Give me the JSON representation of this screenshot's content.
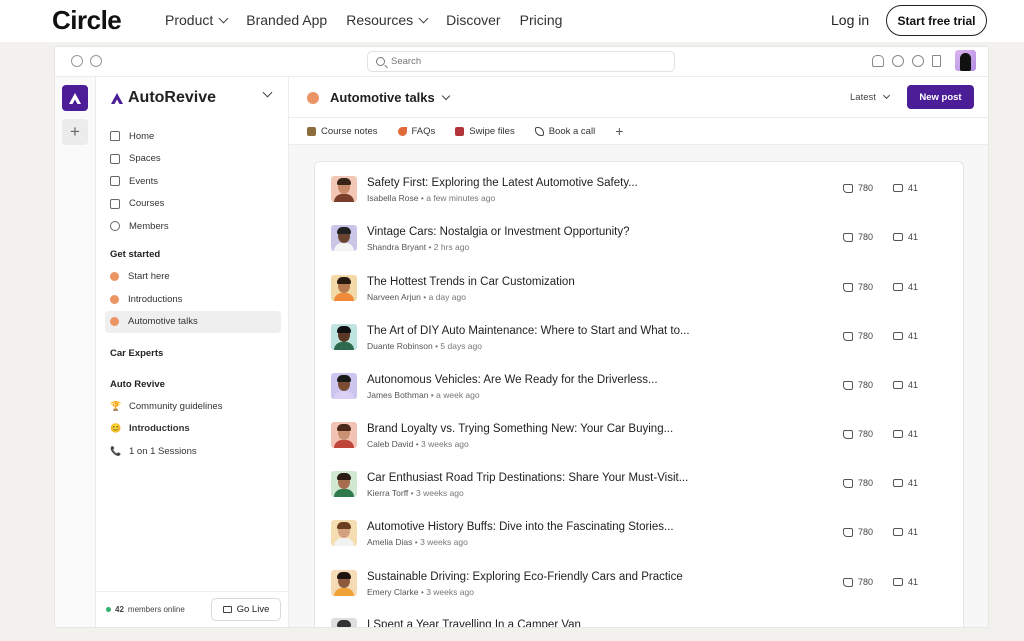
{
  "site_nav": {
    "brand": "Circle",
    "links": [
      {
        "label": "Product",
        "dropdown": true
      },
      {
        "label": "Branded App",
        "dropdown": false
      },
      {
        "label": "Resources",
        "dropdown": true
      },
      {
        "label": "Discover",
        "dropdown": false
      },
      {
        "label": "Pricing",
        "dropdown": false
      }
    ],
    "login": "Log in",
    "cta": "Start free trial"
  },
  "app": {
    "search_placeholder": "Search",
    "community_name": "AutoRevive",
    "accent": "#4b1d96",
    "space_dot_color": "#eb9464"
  },
  "sidebar": {
    "nav": [
      "Home",
      "Spaces",
      "Events",
      "Courses",
      "Members"
    ],
    "get_started": {
      "heading": "Get started",
      "items": [
        "Start here",
        "Introductions",
        "Automotive talks"
      ]
    },
    "car_experts_heading": "Car Experts",
    "auto_revive": {
      "heading": "Auto Revive",
      "items": [
        {
          "icon": "🏆",
          "label": "Community guidelines"
        },
        {
          "icon": "😊",
          "label": "Introductions"
        },
        {
          "icon": "📞",
          "label": "1 on 1 Sessions"
        }
      ]
    },
    "members_online_count": "42",
    "members_online_text": "members online",
    "go_live": "Go Live"
  },
  "main": {
    "space_title": "Automotive talks",
    "sort": "Latest",
    "new_post": "New post",
    "tabs": [
      {
        "label": "Course notes",
        "icon": "notebook-icon",
        "color": "#8a6d3b"
      },
      {
        "label": "FAQs",
        "icon": "rocket-icon",
        "color": "#e06a3a"
      },
      {
        "label": "Swipe files",
        "icon": "book-icon",
        "color": "#b0343a"
      },
      {
        "label": "Book a call",
        "icon": "phone-icon",
        "color": "#444444"
      }
    ]
  },
  "posts": [
    {
      "title": "Safety First: Exploring the Latest Automotive Safety...",
      "author": "Isabella Rose",
      "time": "a few minutes ago",
      "likes": "780",
      "comments": "41"
    },
    {
      "title": "Vintage Cars: Nostalgia or Investment Opportunity?",
      "author": "Shandra Bryant",
      "time": "2 hrs ago",
      "likes": "780",
      "comments": "41"
    },
    {
      "title": "The Hottest Trends in Car Customization",
      "author": "Narveen Arjun",
      "time": "a day ago",
      "likes": "780",
      "comments": "41"
    },
    {
      "title": "The Art of DIY Auto Maintenance: Where to Start and What to...",
      "author": "Duante Robinson",
      "time": "5 days ago",
      "likes": "780",
      "comments": "41"
    },
    {
      "title": "Autonomous Vehicles: Are We Ready for the Driverless...",
      "author": "James Bothman",
      "time": "a week ago",
      "likes": "780",
      "comments": "41"
    },
    {
      "title": "Brand Loyalty vs. Trying Something New: Your Car Buying...",
      "author": "Caleb David",
      "time": "3 weeks ago",
      "likes": "780",
      "comments": "41"
    },
    {
      "title": "Car Enthusiast Road Trip Destinations: Share Your Must-Visit...",
      "author": "Kierra Torff",
      "time": "3 weeks ago",
      "likes": "780",
      "comments": "41"
    },
    {
      "title": "Automotive History Buffs: Dive into the Fascinating Stories...",
      "author": "Amelia Dias",
      "time": "3 weeks ago",
      "likes": "780",
      "comments": "41"
    },
    {
      "title": "Sustainable Driving: Exploring Eco-Friendly Cars and Practice",
      "author": "Emery Clarke",
      "time": "3 weeks ago",
      "likes": "780",
      "comments": "41"
    },
    {
      "title": "I Spent a Year Travelling In a Camper Van",
      "author": "",
      "time": "",
      "likes": "",
      "comments": ""
    }
  ]
}
